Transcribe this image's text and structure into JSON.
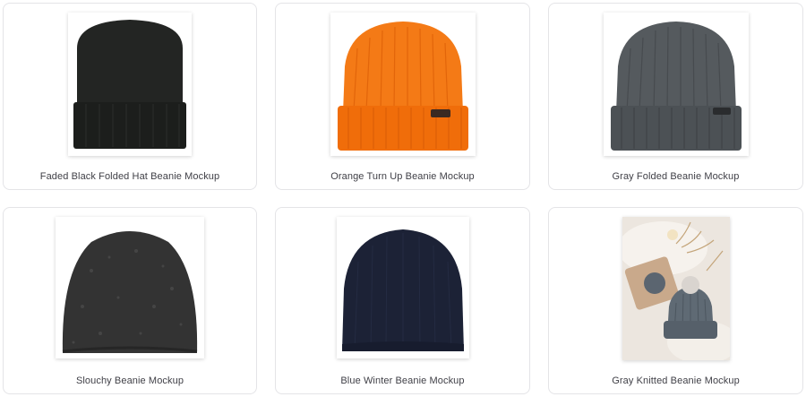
{
  "products": [
    {
      "title": "Faded Black Folded Hat Beanie Mockup",
      "image": "black-folded-beanie-image",
      "color": "#1f211f"
    },
    {
      "title": "Orange Turn Up Beanie Mockup",
      "image": "orange-turn-up-beanie-image",
      "color": "#f4700f"
    },
    {
      "title": "Gray Folded Beanie Mockup",
      "image": "gray-folded-beanie-image",
      "color": "#4f5458"
    },
    {
      "title": "Slouchy Beanie Mockup",
      "image": "slouchy-beanie-image",
      "color": "#2e2e2e"
    },
    {
      "title": "Blue Winter Beanie Mockup",
      "image": "blue-winter-beanie-image",
      "color": "#1b2034"
    },
    {
      "title": "Gray Knitted Beanie Mockup",
      "image": "gray-knitted-beanie-photo",
      "color": "#5b6670"
    }
  ]
}
